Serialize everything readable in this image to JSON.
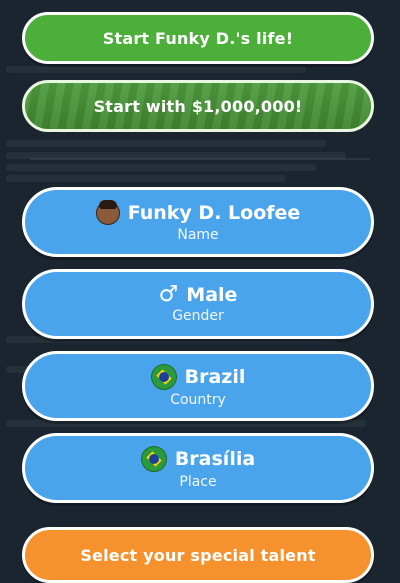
{
  "start_life_label": "Start Funky D.'s life!",
  "start_million_label": "Start with $1,000,000!",
  "name": {
    "value": "Funky D. Loofee",
    "caption": "Name",
    "icon": "avatar-icon"
  },
  "gender": {
    "value": "Male",
    "caption": "Gender",
    "icon": "male-symbol-icon"
  },
  "country": {
    "value": "Brazil",
    "caption": "Country",
    "icon": "brazil-flag-icon"
  },
  "place": {
    "value": "Brasília",
    "caption": "Place",
    "icon": "brazil-flag-icon"
  },
  "talent_label": "Select your special talent",
  "colors": {
    "green": "#4caf3a",
    "blue": "#4aa4ec",
    "orange": "#f5922e",
    "background": "#1b2530"
  }
}
